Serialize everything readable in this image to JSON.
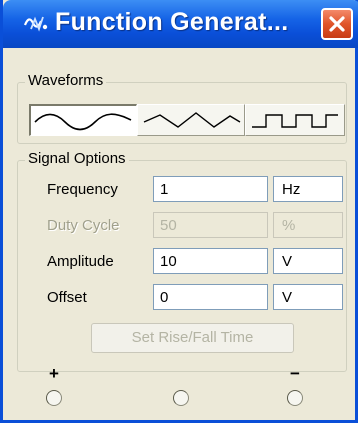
{
  "window": {
    "title": "Function Generat...",
    "close_icon": "close-icon",
    "app_icon": "function-generator-icon"
  },
  "waveforms": {
    "label": "Waveforms",
    "options": [
      {
        "icon": "sine-wave-icon",
        "selected": true
      },
      {
        "icon": "triangle-wave-icon",
        "selected": false
      },
      {
        "icon": "square-wave-icon",
        "selected": false
      }
    ]
  },
  "signal_options": {
    "label": "Signal Options",
    "frequency": {
      "label": "Frequency",
      "value": "1",
      "unit": "Hz",
      "enabled": true
    },
    "duty_cycle": {
      "label": "Duty Cycle",
      "value": "50",
      "unit": "%",
      "enabled": false
    },
    "amplitude": {
      "label": "Amplitude",
      "value": "10",
      "unit": "V",
      "enabled": true
    },
    "offset": {
      "label": "Offset",
      "value": "0",
      "unit": "V",
      "enabled": true
    },
    "rise_fall_button": "Set Rise/Fall Time"
  },
  "terminals": {
    "plus": "+",
    "minus": "−"
  },
  "colors": {
    "titlebar": "#0a4fd8",
    "close_button": "#e0542a",
    "dialog_face": "#ece9d8"
  }
}
